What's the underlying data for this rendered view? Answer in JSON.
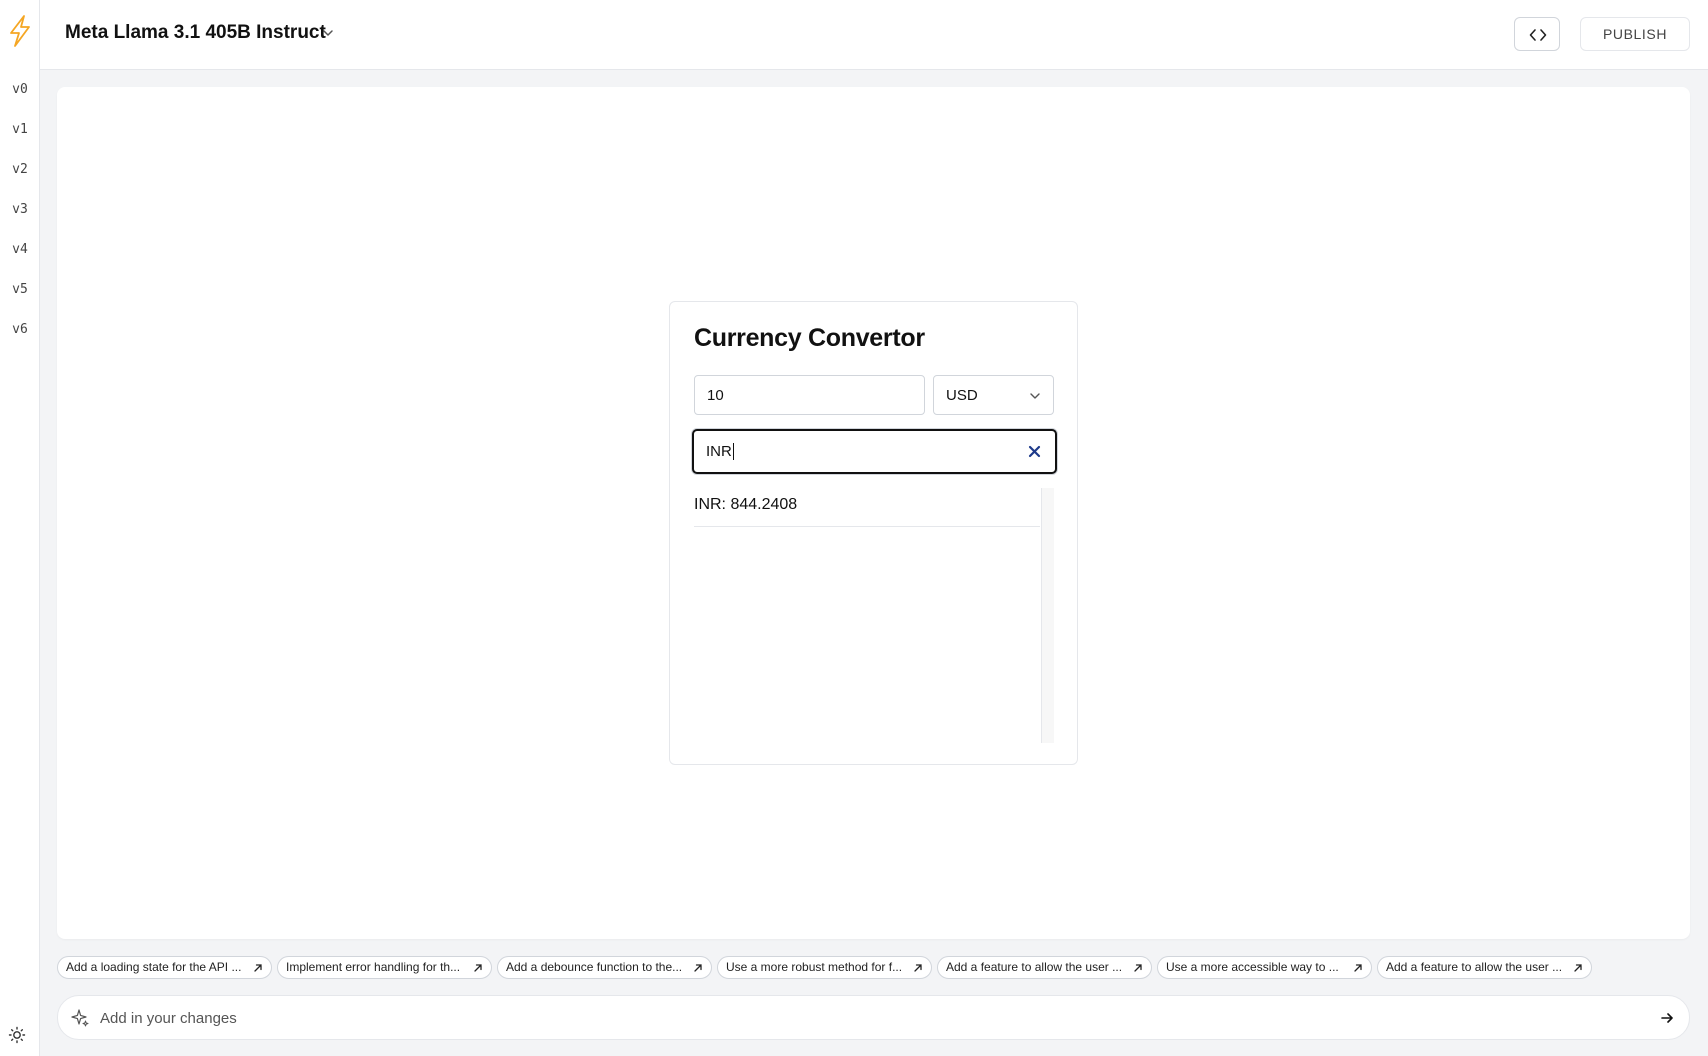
{
  "sidebar": {
    "logo_icon": "lightning-bolt-icon",
    "logo_color": "#f5a623",
    "versions": [
      "v0",
      "v1",
      "v2",
      "v3",
      "v4",
      "v5",
      "v6"
    ],
    "theme_icon": "sun-icon"
  },
  "header": {
    "model_name": "Meta Llama 3.1 405B Instruct",
    "model_chevron_icon": "chevron-down-icon",
    "code_icon": "code-brackets-icon",
    "publish_label": "PUBLISH"
  },
  "app": {
    "title": "Currency Convertor",
    "amount_value": "10",
    "base_currency": "USD",
    "search_value": "INR",
    "clear_icon": "close-icon",
    "results": [
      "INR: 844.2408"
    ]
  },
  "suggestions": [
    "Add a loading state for the API ...",
    "Implement error handling for th...",
    "Add a debounce function to the...",
    "Use a more robust method for f...",
    "Add a feature to allow the user ...",
    "Use a more accessible way to ...",
    "Add a feature to allow the user ..."
  ],
  "prompt": {
    "placeholder": "Add in your changes",
    "sparkle_icon": "sparkle-icon",
    "send_icon": "arrow-right-icon"
  }
}
